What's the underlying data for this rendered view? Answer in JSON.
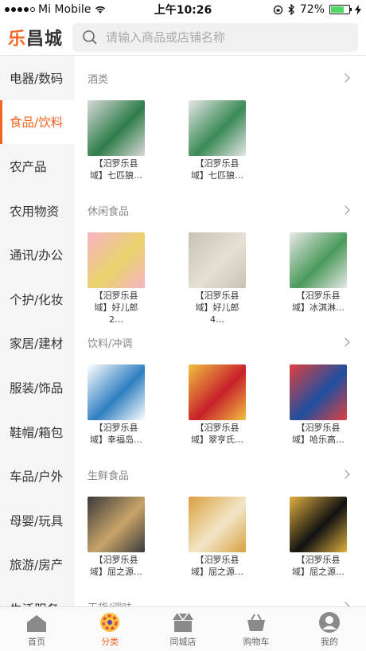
{
  "status_bar": {
    "carrier": "Mi Mobile",
    "time": "上午10:26",
    "battery": "72%",
    "battery_level": 0.72
  },
  "header": {
    "logo": "乐昌城",
    "search_placeholder": "请输入商品或店铺名称"
  },
  "sidebar": {
    "items": [
      {
        "label": "电器/数码"
      },
      {
        "label": "食品/饮料",
        "active": true
      },
      {
        "label": "农产品"
      },
      {
        "label": "农用物资"
      },
      {
        "label": "通讯/办公"
      },
      {
        "label": "个护/化妆"
      },
      {
        "label": "家居/建材"
      },
      {
        "label": "服装/饰品"
      },
      {
        "label": "鞋帽/箱包"
      },
      {
        "label": "车品/户外"
      },
      {
        "label": "母婴/玩具"
      },
      {
        "label": "旅游/房产"
      },
      {
        "label": "生活服务"
      }
    ]
  },
  "sections": [
    {
      "title": "酒类",
      "products": [
        {
          "line1": "【汨罗乐县",
          "line2": "域】七匹狼…",
          "colors": [
            "#2f7d4a",
            "#d9d9d9"
          ]
        },
        {
          "line1": "【汨罗乐县",
          "line2": "域】七匹狼…",
          "colors": [
            "#3a8a55",
            "#e6e6e6"
          ]
        }
      ]
    },
    {
      "title": "休闲食品",
      "products": [
        {
          "line1": "【汨罗乐县",
          "line2": "域】好儿郎2…",
          "colors": [
            "#e9d36b",
            "#f7b4c4"
          ]
        },
        {
          "line1": "【汨罗乐县",
          "line2": "域】好儿郎4…",
          "colors": [
            "#e6e0d4",
            "#c8c2b5"
          ]
        },
        {
          "line1": "【汨罗乐县",
          "line2": "域】冰淇淋…",
          "colors": [
            "#4a9a5a",
            "#e8e8e8"
          ]
        }
      ]
    },
    {
      "title": "饮料/冲调",
      "products": [
        {
          "line1": "【汨罗乐县",
          "line2": "域】幸福岛…",
          "colors": [
            "#2e7fc1",
            "#ffffff"
          ]
        },
        {
          "line1": "【汨罗乐县",
          "line2": "域】翠亨氏…",
          "colors": [
            "#c8202a",
            "#f0c040"
          ]
        },
        {
          "line1": "【汨罗乐县",
          "line2": "域】哈乐高…",
          "colors": [
            "#1f4fa0",
            "#e04040"
          ]
        }
      ]
    },
    {
      "title": "生鲜食品",
      "products": [
        {
          "line1": "【汨罗乐县",
          "line2": "域】屈之源…",
          "colors": [
            "#c9a46a",
            "#3a3a3a"
          ]
        },
        {
          "line1": "【汨罗乐县",
          "line2": "域】屈之源…",
          "colors": [
            "#f2e6c8",
            "#d9a040"
          ]
        },
        {
          "line1": "【汨罗乐县",
          "line2": "域】屈之源…",
          "colors": [
            "#111111",
            "#e0b040"
          ]
        }
      ]
    },
    {
      "title": "干货/调味",
      "products": []
    }
  ],
  "tabbar": {
    "items": [
      {
        "label": "首页",
        "icon": "home-icon"
      },
      {
        "label": "分类",
        "icon": "category-icon",
        "active": true
      },
      {
        "label": "同城店",
        "icon": "store-icon"
      },
      {
        "label": "购物车",
        "icon": "cart-icon"
      },
      {
        "label": "我的",
        "icon": "profile-icon"
      }
    ]
  },
  "colors": {
    "accent": "#f26522",
    "sidebar_bg": "#f5f5f5"
  }
}
